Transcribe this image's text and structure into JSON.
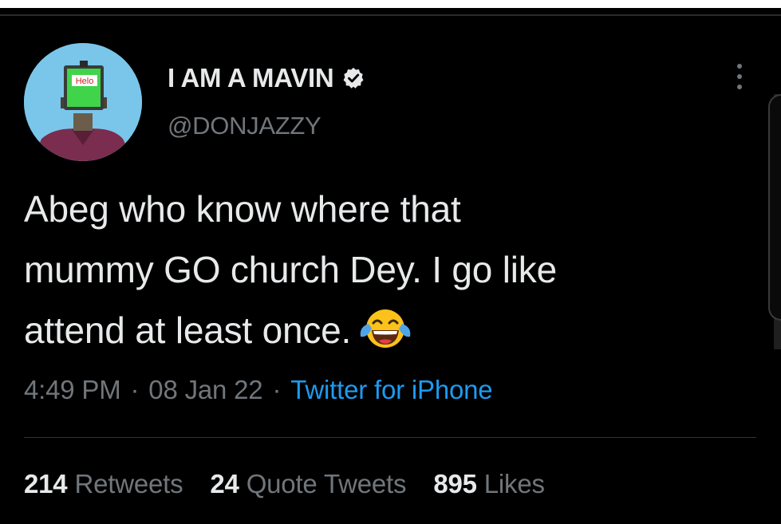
{
  "tweet": {
    "author": {
      "display_name": "I AM A MAVIN",
      "handle": "@DONJAZZY",
      "verified": true,
      "avatar_sign_text": "Helo"
    },
    "text_lines": [
      "Abeg who know where that",
      "mummy GO church Dey. I go like",
      "attend at least once."
    ],
    "emoji": "face-with-tears-of-joy",
    "time": "4:49 PM",
    "date": "08 Jan 22",
    "separator": "·",
    "source": "Twitter for iPhone",
    "stats": {
      "retweets_count": "214",
      "retweets_label": "Retweets",
      "quotes_count": "24",
      "quotes_label": "Quote Tweets",
      "likes_count": "895",
      "likes_label": "Likes"
    }
  },
  "colors": {
    "background": "#000000",
    "primary_text": "#e7e9ea",
    "secondary_text": "#71767b",
    "link": "#1d9bf0",
    "divider": "#2f3336"
  }
}
